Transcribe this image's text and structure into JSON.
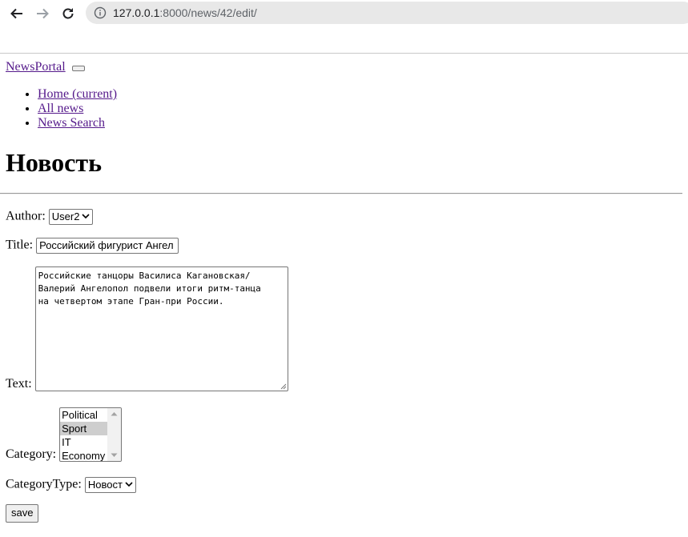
{
  "browser": {
    "url_host": "127.0.0.1",
    "url_rest": ":8000/news/42/edit/"
  },
  "navbar": {
    "brand": "NewsPortal",
    "items": [
      {
        "label": "Home (current)"
      },
      {
        "label": "All news"
      },
      {
        "label": "News Search"
      }
    ]
  },
  "page": {
    "title": "Новость"
  },
  "form": {
    "author_label": "Author:",
    "author_value": "User2",
    "title_label": "Title:",
    "title_value": "Российский фигурист Ангел",
    "text_label": "Text:",
    "text_value": "Российские танцоры Василиса Кагановская/\nВалерий Ангелопол подвели итоги ритм-танца\nна четвертом этапе Гран-при России.",
    "category_label": "Category:",
    "category_options": [
      "Political",
      "Sport",
      "IT",
      "Economy"
    ],
    "category_selected": "Sport",
    "category_type_label": "CategoryType:",
    "category_type_value": "Новост",
    "save_label": "save"
  },
  "colors": {
    "link": "#551a8b",
    "selected_option": "#cecece"
  }
}
